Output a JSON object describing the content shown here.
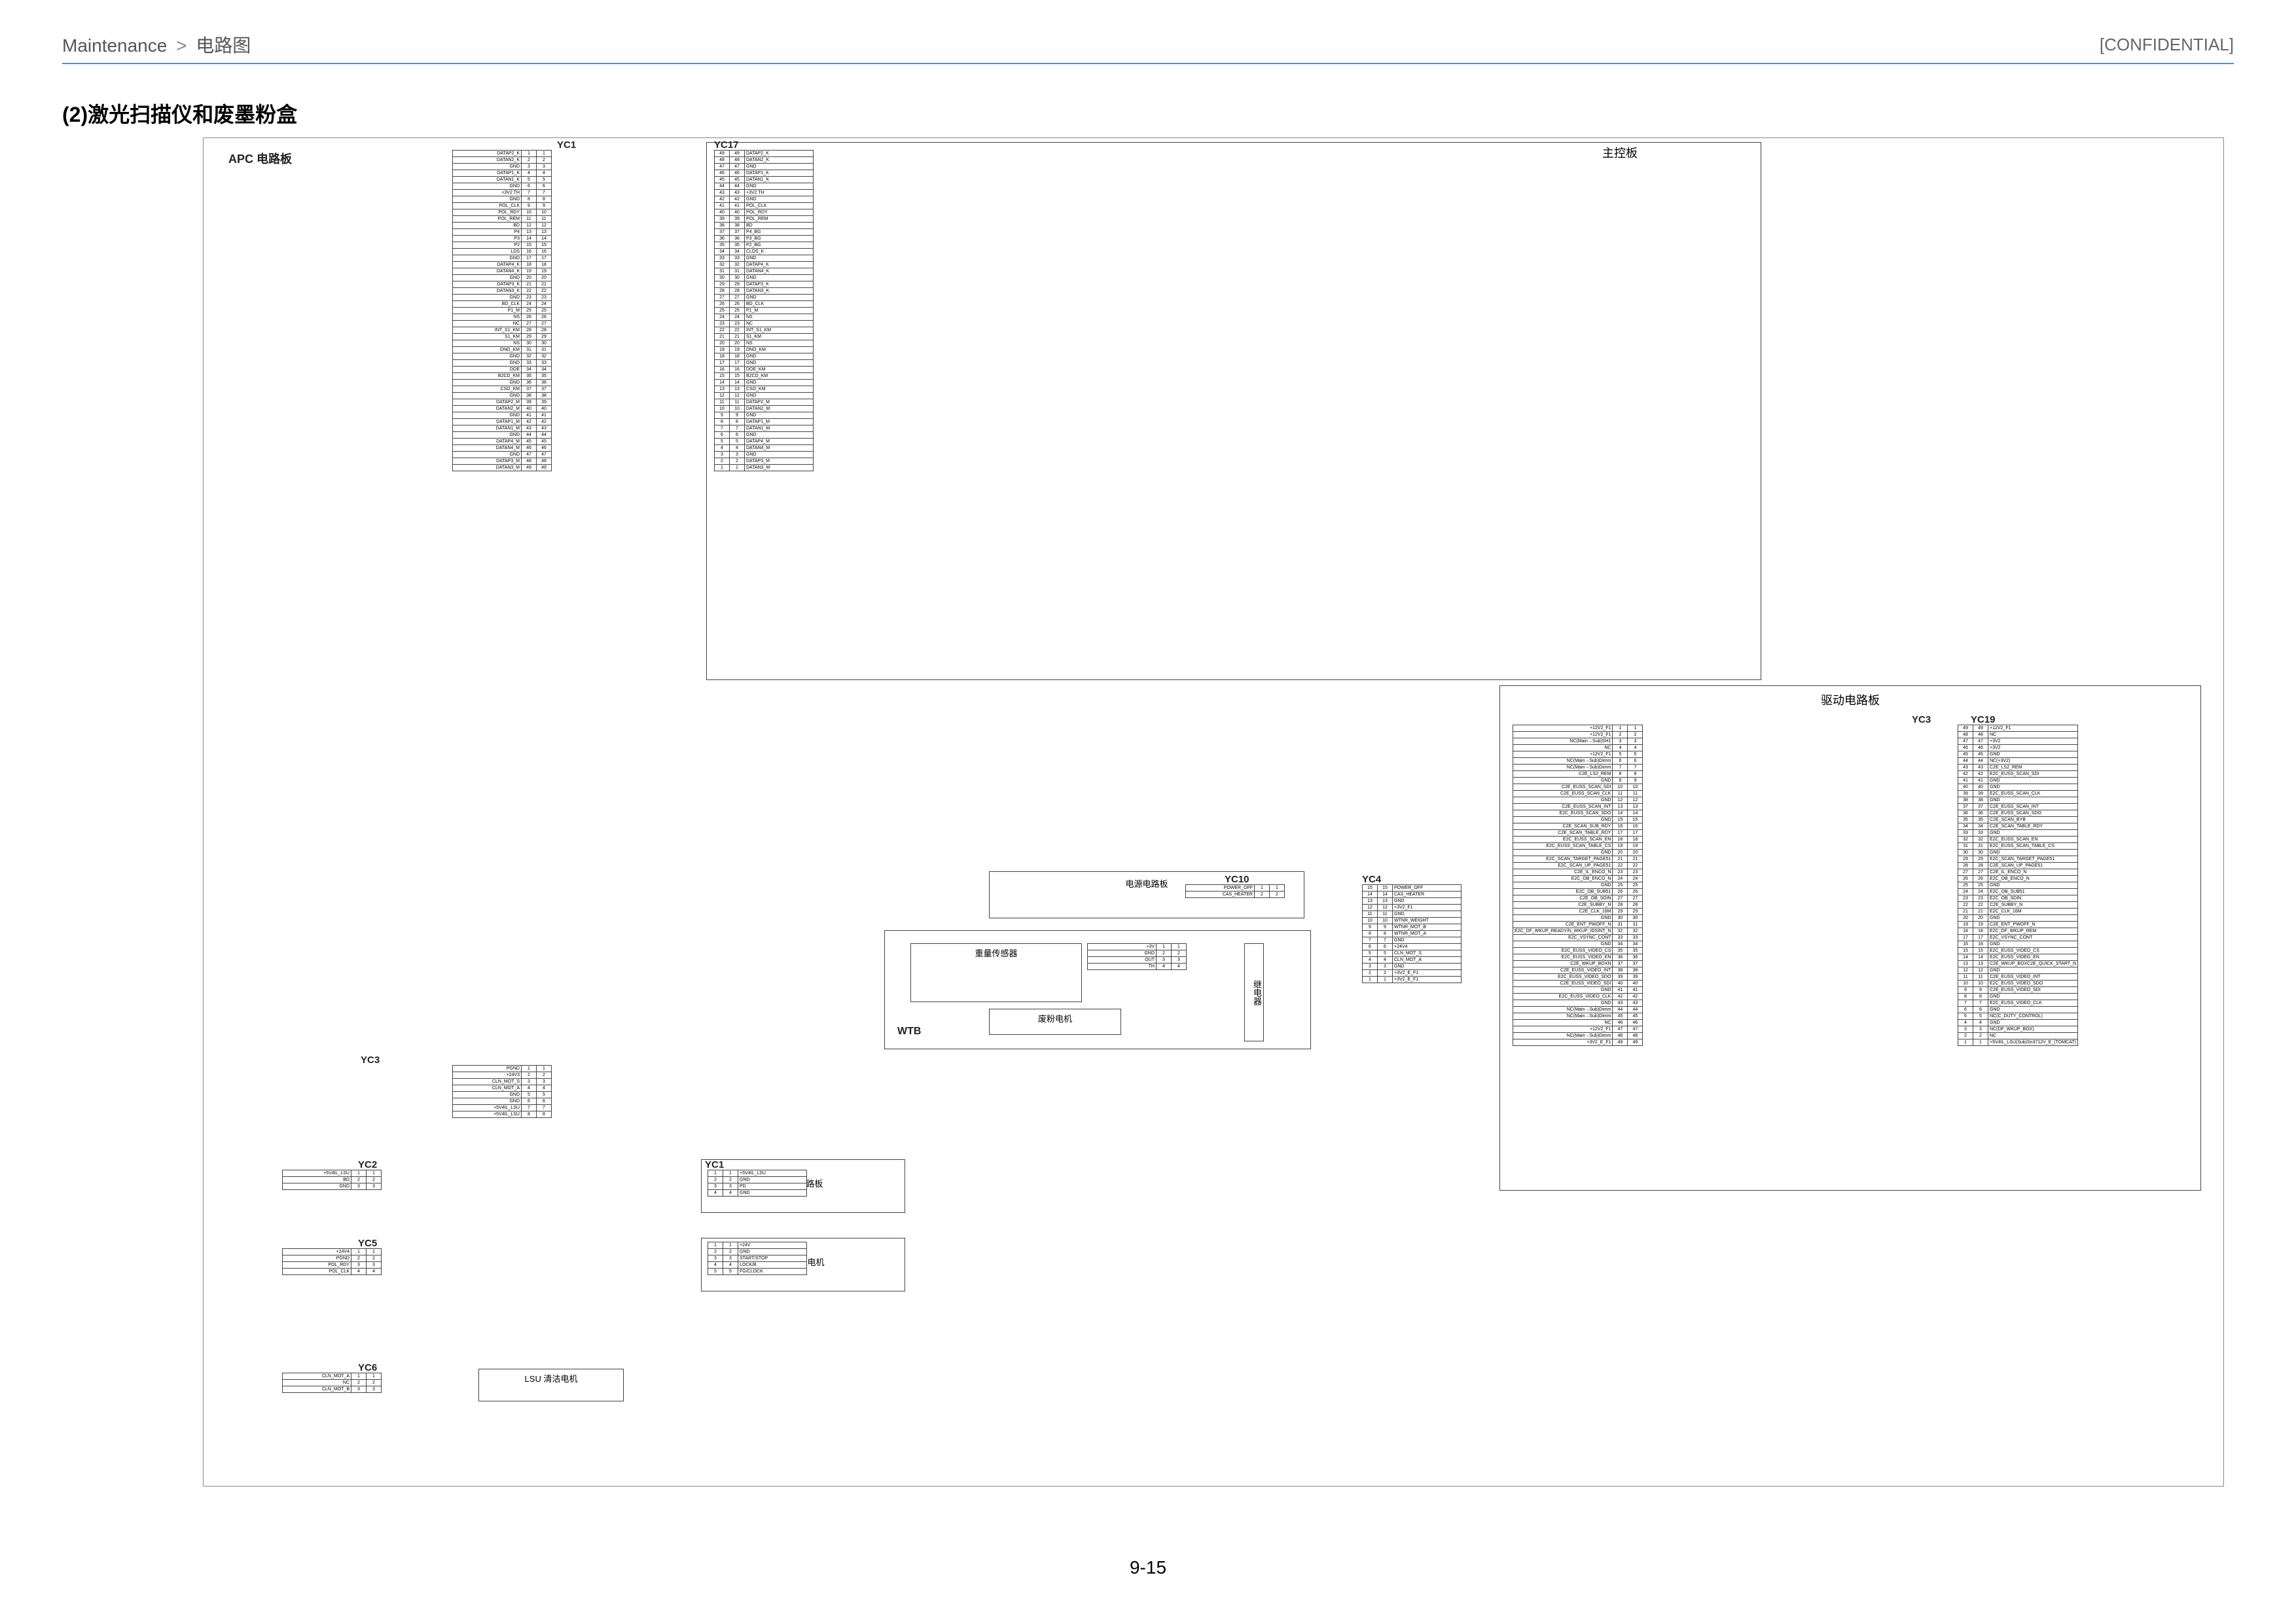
{
  "header": {
    "breadcrumb_root": "Maintenance",
    "breadcrumb_leaf": "电路图",
    "confidential": "[CONFIDENTIAL]"
  },
  "section_title": "(2)激光扫描仪和废墨粉盒",
  "page_number": "9-15",
  "boards": {
    "apc": "APC 电路板",
    "main": "主控板",
    "drive": "驱动电路板",
    "relay": "电源电路板",
    "pd": "PD 电路板",
    "polygon": "多棱镜电机",
    "lsu": "LSU 清洁电机",
    "wtb": "WTB",
    "weight_sensor": "重量传感器",
    "waste_motor": "废粉电机",
    "relay2": "继电器"
  },
  "connectors": {
    "yc1": "YC1",
    "yc2": "YC2",
    "yc3": "YC3",
    "yc4": "YC4",
    "yc5": "YC5",
    "yc6": "YC6",
    "yc10": "YC10",
    "yc17": "YC17",
    "yc19": "YC19"
  },
  "apc_yc1": [
    "DATAP2_K",
    "DATAN2_K",
    "GND",
    "DATAP1_K",
    "DATAN1_K",
    "GND",
    "+3V2 TH",
    "GND",
    "POL_CLK",
    "POL_RDY",
    "POL_REM",
    "BD",
    "P4",
    "P3",
    "P2",
    "LDS",
    "GND",
    "DATAP4_K",
    "DATAN4_K",
    "GND",
    "DATAP3_K",
    "DATAN3_K",
    "GND",
    "BD_CLK",
    "P1_M",
    "NS",
    "NC",
    "INT_S1_KM",
    "S1_KM",
    "NS",
    "DNO_KM",
    "GND",
    "GND",
    "DOE",
    "B2CD_KM",
    "GND",
    "CSO_KM",
    "GND",
    "DATAP2_M",
    "DATAN2_M",
    "GND",
    "DATAP1_M",
    "DATAN1_M",
    "GND",
    "DATAP4_M",
    "DATAN4_M",
    "GND",
    "DATAP3_M",
    "DATAN3_M"
  ],
  "main_yc17": [
    "DATAP2_K",
    "DATAN2_K",
    "GND",
    "DATAP1_K",
    "DATAN1_K",
    "GND",
    "+3V2 TH",
    "GND",
    "POL_CLK",
    "POL_RDY",
    "POL_REM",
    "BD",
    "P4_BG",
    "P3_BG",
    "P2_BG",
    "CLDS_K",
    "GND",
    "DATAP4_K",
    "DATAN4_K",
    "GND",
    "DATAP3_K",
    "DATAN3_K",
    "GND",
    "BD_CLK",
    "P1_M",
    "NS",
    "NC",
    "INT_S1_KM",
    "S1_KM",
    "NS",
    "DNO_KM",
    "GND",
    "GND",
    "DOE_KM",
    "B2CD_KM",
    "GND",
    "CSO_KM",
    "GND",
    "DATAP2_M",
    "DATAN2_M",
    "GND",
    "DATAP1_M",
    "DATAN1_M",
    "GND",
    "DATAP4_M",
    "DATAN4_M",
    "GND",
    "DATAP3_M",
    "DATAN3_M"
  ],
  "drive_yc3": [
    "+12V2_F1",
    "+12V2_F1",
    "NC(Main→Sub)SH1",
    "NC",
    "+12V2_F1",
    "NC(Main→Sub)Dimm",
    "NC(Main→Sub)Dimm",
    "C2E_LS2_REM",
    "GND",
    "C2E_EUSS_SCAN_SDI",
    "C2E_EUSS_SCAN_CLK",
    "GND",
    "C2E_EUSS_SCAN_INT",
    "E2C_EUSS_SCAN_SDO",
    "GND",
    "C2E_SCAN_SUB_RDY",
    "C2E_SCAN_TABLE_RDY",
    "E2C_EUSS_SCAN_EN",
    "E2C_EUSS_SCAN_TABLE_CS",
    "GND",
    "E2C_SCAN_TARGET_PAGE51",
    "E2C_SCAN_UP_PAGE51",
    "C2E_IL_ENCO_N",
    "E2C_OB_ENCO_N",
    "GND",
    "E2C_OB_SUB51",
    "C2E_OB_SDIN",
    "C2E_SUBBY_N",
    "C2E_CLK_16M",
    "GND",
    "C2E_ENT_PWOFF_N",
    "E2C_DF_WKUP_READY/N_WKUP_IDSINT_N",
    "E2C_VSYNC_CONT",
    "GND",
    "E2C_EUSS_VIDEO_CS",
    "E2C_EUSS_VIDEO_EN",
    "C2E_WKUP_BOXN",
    "C2E_EUSS_VIDEO_INT",
    "E2C_EUSS_VIDEO_SDO",
    "C2E_EUSS_VIDEO_SDI",
    "GND",
    "E2C_EUSS_VIDEO_CLK",
    "GND",
    "NC(Main→Sub)Dimm",
    "NC(Main→Sub)Dimm",
    "NC",
    "+12V2_F1",
    "NC(Main→Sub)Dimm",
    "+3V2_E_F1"
  ],
  "drive_yc19": [
    "+12V2_F1",
    "NC",
    "+3V2",
    "+3V2",
    "GND",
    "NC(+3V2)",
    "C2E_LS2_REM",
    "E2C_EUSS_SCAN_SDI",
    "GND",
    "GND",
    "E2C_EUSS_SCAN_CLK",
    "GND",
    "C2E_EUSS_SCAN_INT",
    "C2E_EUSS_SCAN_SDO",
    "C2E_SCAN_BYB",
    "C2E_SCAN_TABLE_RDY",
    "GND",
    "E2C_EUSS_SCAN_EN",
    "E2C_EUSS_SCAN_TABLE_CS",
    "GND",
    "E2C_SCAN_TARGET_PAGE51",
    "C2E_SCAN_UP_PAGE51",
    "C2E_IL_ENCO_N",
    "E2C_OB_ENCO_N",
    "GND",
    "E2C_OB_SUB51",
    "E2C_OB_SDIN",
    "C2E_SUBBY_N",
    "E2C_CLK_16M",
    "GND",
    "C2E_ENT_PWOFF_N",
    "E2C_DF_WKUP_REM",
    "E2C_VSYNC_CONT",
    "GND",
    "E2C_EUSS_VIDEO_CS",
    "E2C_EUSS_VIDEO_EN",
    "C2E_WKUP_BOXC2E_QUICK_START_N",
    "GND",
    "C2E_EUSS_VIDEO_INT",
    "E2C_EUSS_VIDEO_SDO",
    "C2E_EUSS_VIDEO_SDI",
    "GND",
    "E2C_EUSS_VIDEO_CLK",
    "GND",
    "NC(C_DUTY_CONTROL)",
    "GND",
    "NC(DF_WKUP_BOX)",
    "NC",
    "+5V4IL_LSU(Sub)Sn3712V_E_(TOMCAT)"
  ],
  "yc3_left": [
    "PGND",
    "+24V3",
    "CLN_MOT_S",
    "CLN_MOT_A",
    "GND",
    "GND",
    "+5V4IL_LSU",
    "+5V4IL_LSU"
  ],
  "yc4_right": [
    "POWER_OFF",
    "CAS_HEATER",
    "GND",
    "+3V2_F1",
    "GND",
    "WTNR_WEIGHT",
    "WTNR_MOT_B",
    "WTNR_MOT_A",
    "GND",
    "+24V4",
    "CLN_MOT_S",
    "CLN_MOT_A",
    "GND",
    "+3V2_E_F1",
    "+3V2_E_F1"
  ],
  "yc10_relay": [
    "POWER_OFF",
    "CAS_HEATER"
  ],
  "weight_sensor_pins": [
    "+3V",
    "GND",
    "OUT",
    "TH"
  ],
  "pd_yc2_left": [
    "+5V4IL_LSU",
    "BD",
    "GND"
  ],
  "pd_yc1_right": [
    "+5V4IL_LSU",
    "GND",
    "PD",
    "GND"
  ],
  "polygon_yc5_left": [
    "+24V4",
    "PGND",
    "POL_RDY",
    "POL_CLK"
  ],
  "polygon_right": [
    "+24V",
    "GND",
    "START/STOP",
    "LOCK/B",
    "FG/CLOCK"
  ],
  "yc6_lsu": [
    "CLN_MOT_A",
    "NC",
    "CLN_MOT_B"
  ]
}
